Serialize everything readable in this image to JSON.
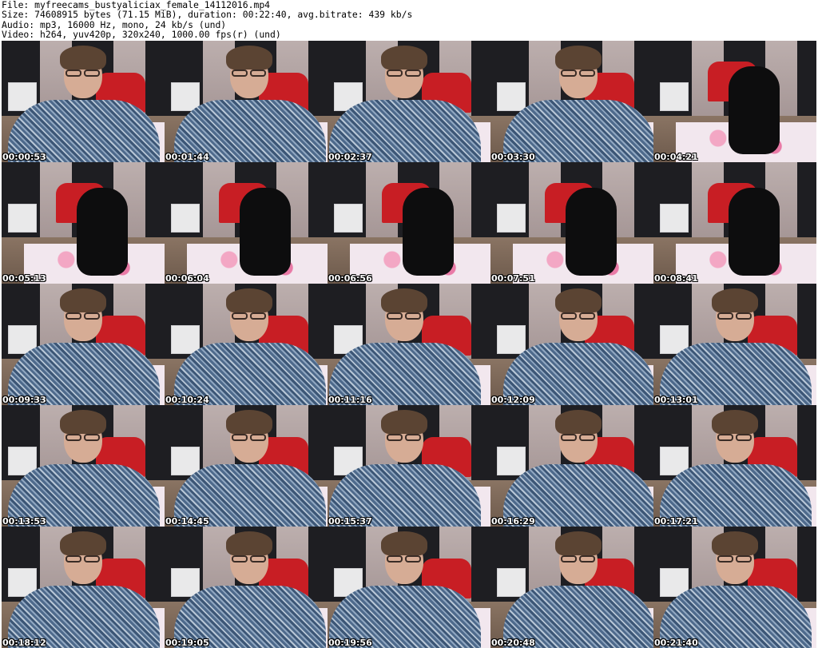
{
  "header": {
    "file_line": "File: myfreecams_bustyaliciax_female_14112016.mp4",
    "size_line": "Size: 74608915 bytes (71.15 MiB), duration: 00:22:40, avg.bitrate: 439 kb/s",
    "audio_line": "Audio: mp3, 16000 Hz, mono, 24 kb/s (und)",
    "video_line": "Video: h264, yuv420p, 320x240, 1000.00 fps(r) (und)"
  },
  "thumbnails": [
    {
      "time": "00:00:53",
      "scene": "person"
    },
    {
      "time": "00:01:44",
      "scene": "person"
    },
    {
      "time": "00:02:37",
      "scene": "person"
    },
    {
      "time": "00:03:30",
      "scene": "person"
    },
    {
      "time": "00:04:21",
      "scene": "chair"
    },
    {
      "time": "00:05:13",
      "scene": "chair"
    },
    {
      "time": "00:06:04",
      "scene": "chair"
    },
    {
      "time": "00:06:56",
      "scene": "chair"
    },
    {
      "time": "00:07:51",
      "scene": "chair"
    },
    {
      "time": "00:08:41",
      "scene": "chair"
    },
    {
      "time": "00:09:33",
      "scene": "person"
    },
    {
      "time": "00:10:24",
      "scene": "person"
    },
    {
      "time": "00:11:16",
      "scene": "person"
    },
    {
      "time": "00:12:09",
      "scene": "person"
    },
    {
      "time": "00:13:01",
      "scene": "person"
    },
    {
      "time": "00:13:53",
      "scene": "person"
    },
    {
      "time": "00:14:45",
      "scene": "person"
    },
    {
      "time": "00:15:37",
      "scene": "person"
    },
    {
      "time": "00:16:29",
      "scene": "person"
    },
    {
      "time": "00:17:21",
      "scene": "person"
    },
    {
      "time": "00:18:12",
      "scene": "person"
    },
    {
      "time": "00:19:05",
      "scene": "person"
    },
    {
      "time": "00:19:56",
      "scene": "person"
    },
    {
      "time": "00:20:48",
      "scene": "person"
    },
    {
      "time": "00:21:40",
      "scene": "person"
    }
  ]
}
